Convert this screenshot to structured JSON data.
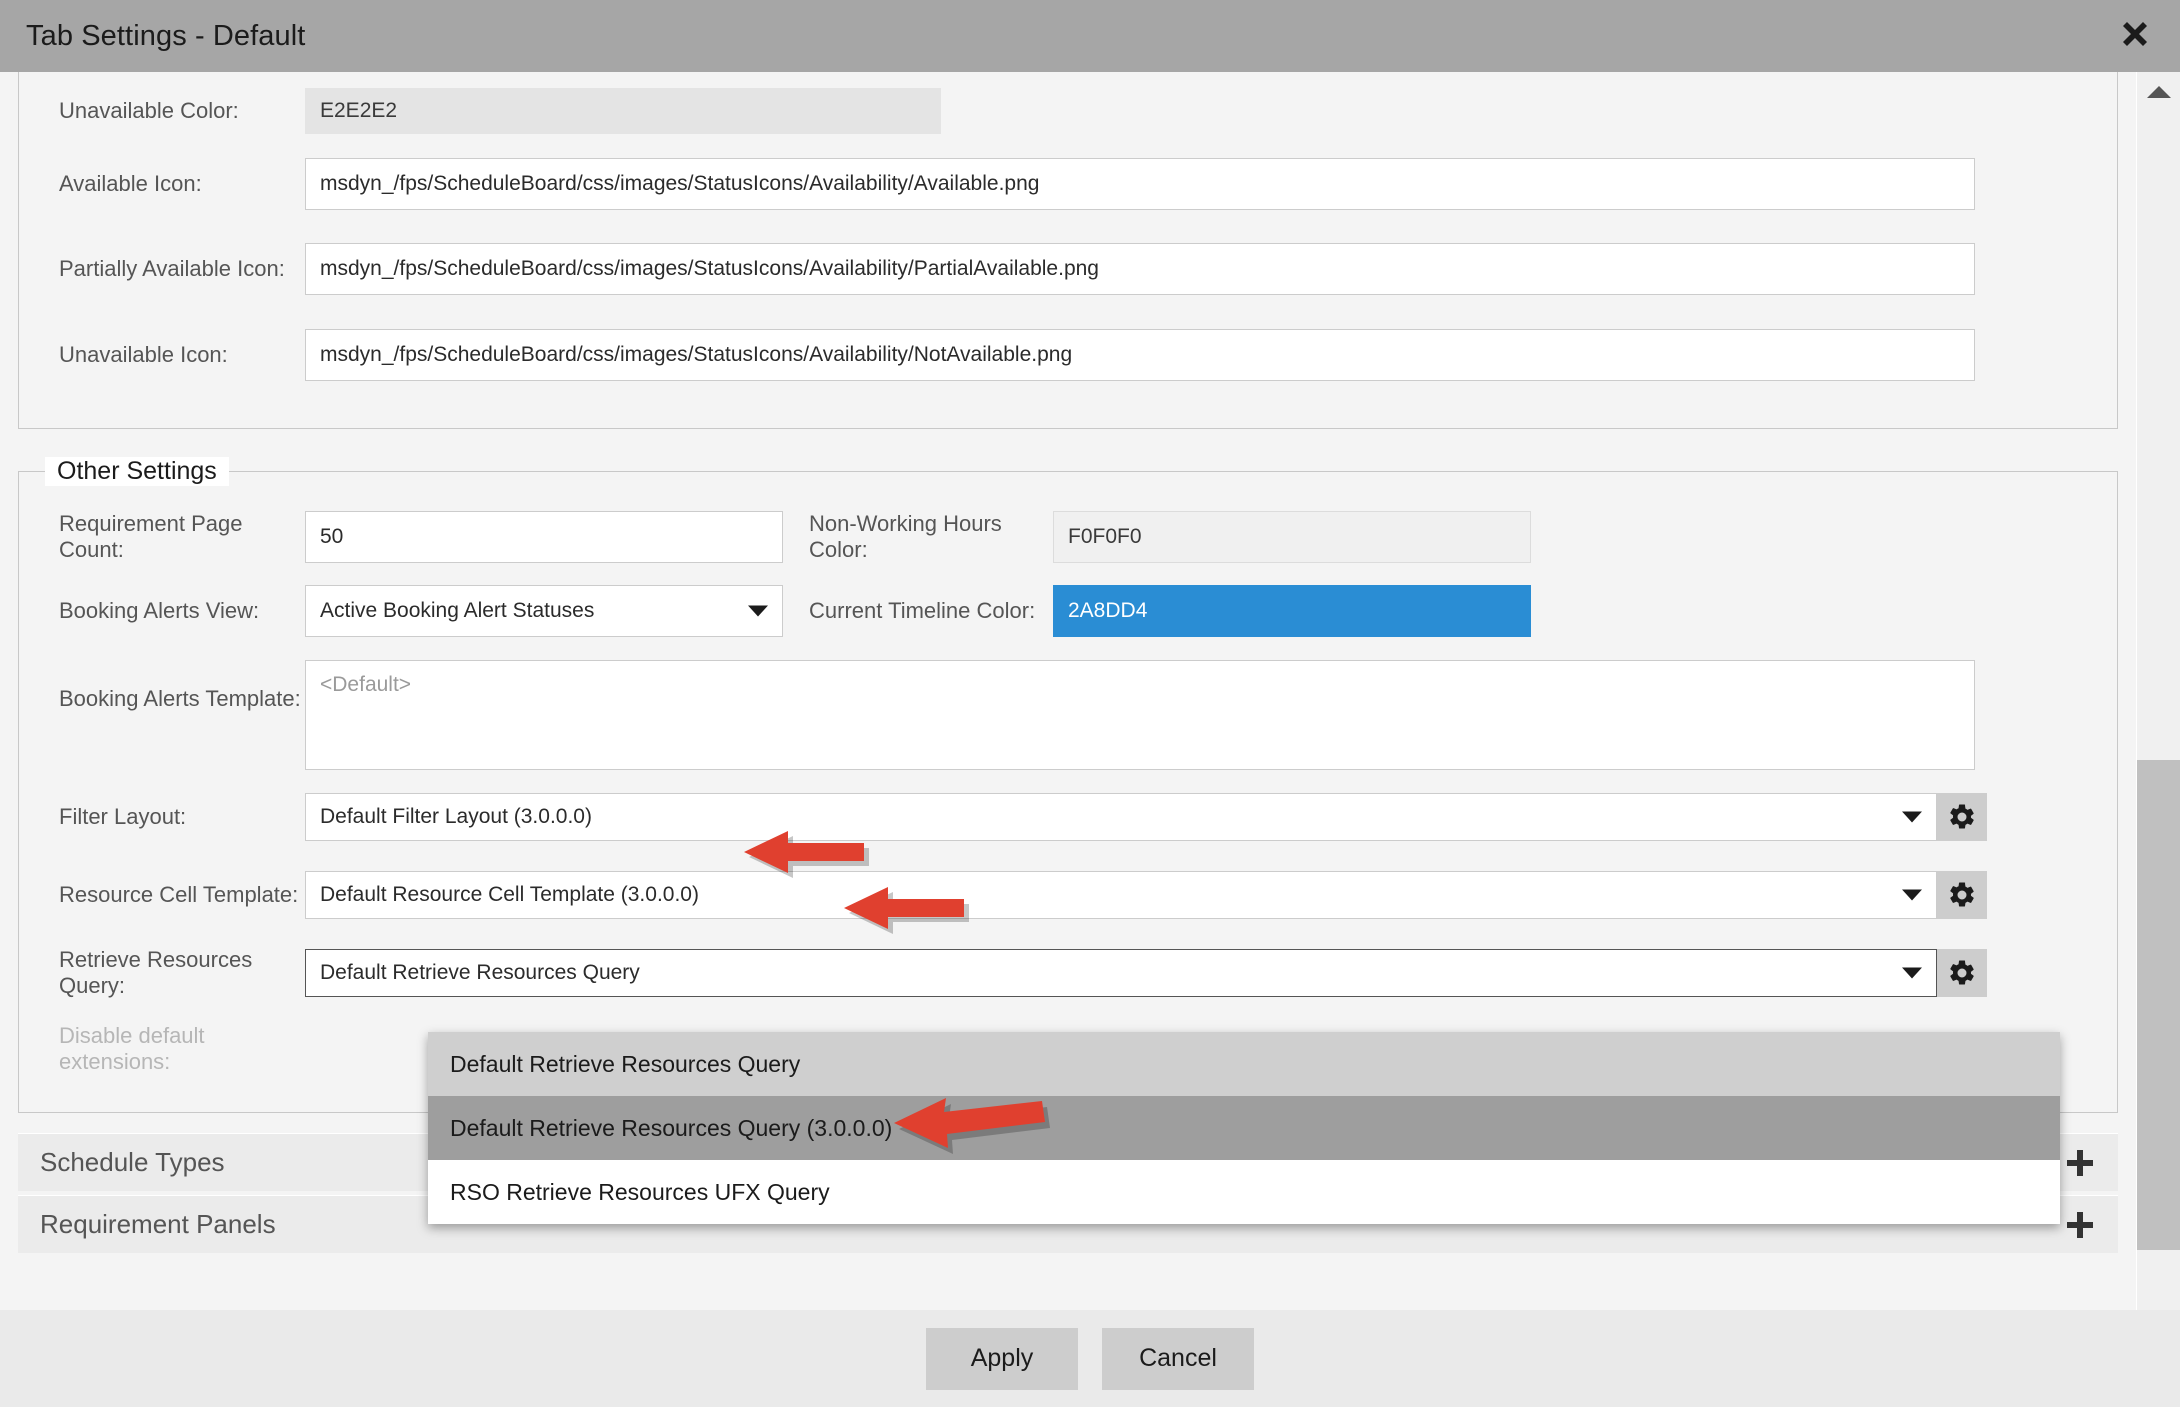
{
  "window": {
    "title": "Tab Settings - Default",
    "close_icon": "close-icon"
  },
  "availability_section": {
    "fields": [
      {
        "label": "Unavailable Color:",
        "value": "E2E2E2",
        "readonly": true
      },
      {
        "label": "Available Icon:",
        "value": "msdyn_/fps/ScheduleBoard/css/images/StatusIcons/Availability/Available.png",
        "readonly": false
      },
      {
        "label": "Partially Available Icon:",
        "value": "msdyn_/fps/ScheduleBoard/css/images/StatusIcons/Availability/PartialAvailable.png",
        "readonly": false
      },
      {
        "label": "Unavailable Icon:",
        "value": "msdyn_/fps/ScheduleBoard/css/images/StatusIcons/Availability/NotAvailable.png",
        "readonly": false
      }
    ]
  },
  "other_settings": {
    "legend": "Other Settings",
    "requirement_page_count": {
      "label": "Requirement Page Count:",
      "value": "50"
    },
    "non_working_hours_color": {
      "label": "Non-Working Hours Color:",
      "value": "F0F0F0",
      "color": "#f0f0f0"
    },
    "booking_alerts_view": {
      "label": "Booking Alerts View:",
      "value": "Active Booking Alert Statuses"
    },
    "current_timeline_color": {
      "label": "Current Timeline Color:",
      "value": "2A8DD4",
      "color": "#2a8dd4"
    },
    "booking_alerts_template": {
      "label": "Booking Alerts Template:",
      "placeholder": "<Default>",
      "value": ""
    },
    "filter_layout": {
      "label": "Filter Layout:",
      "value": "Default Filter Layout (3.0.0.0)",
      "gear_icon": "gear-icon"
    },
    "resource_cell_template": {
      "label": "Resource Cell Template:",
      "value": "Default Resource Cell Template (3.0.0.0)",
      "gear_icon": "gear-icon"
    },
    "retrieve_resources_query": {
      "label": "Retrieve Resources Query:",
      "value": "Default Retrieve Resources Query",
      "gear_icon": "gear-icon"
    },
    "disable_default_extensions": {
      "label": "Disable default extensions:",
      "disabled": true
    }
  },
  "dropdown": {
    "options": [
      {
        "label": "Default Retrieve Resources Query",
        "state": "hl-light"
      },
      {
        "label": "Default Retrieve Resources Query (3.0.0.0)",
        "state": "hl-dark"
      },
      {
        "label": "RSO Retrieve Resources UFX Query",
        "state": "normal"
      }
    ]
  },
  "accordions": [
    {
      "title": "Schedule Types",
      "add_icon": "plus-icon"
    },
    {
      "title": "Requirement Panels",
      "add_icon": "plus-icon"
    }
  ],
  "footer": {
    "apply_label": "Apply",
    "cancel_label": "Cancel"
  },
  "scrollbar": {
    "up_icon": "caret-up-icon",
    "down_icon": "caret-down-icon"
  },
  "annotations": {
    "color": "#e0402f",
    "arrows": [
      {
        "name": "arrow-filter-layout"
      },
      {
        "name": "arrow-resource-cell-template"
      },
      {
        "name": "arrow-dropdown-selected-option"
      }
    ]
  }
}
